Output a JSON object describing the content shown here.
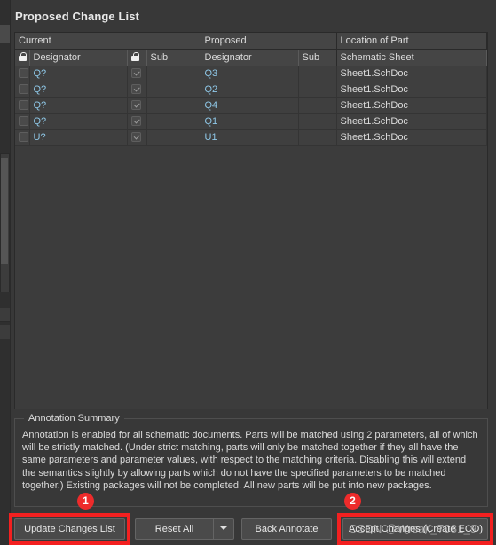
{
  "page_title": "Proposed Change List",
  "colors": {
    "window_bg": "#383838",
    "panel_bg": "#3c3c3c",
    "row_bg": "#3f3f3f",
    "header_bg": "#454545",
    "designator_text": "#8fc8e8",
    "highlight_red": "#f32020",
    "badge_red": "#ee2b2b"
  },
  "table": {
    "group_headers": [
      {
        "label": "Current"
      },
      {
        "label": "Proposed"
      },
      {
        "label": "Location of Part"
      }
    ],
    "sub_headers": {
      "current_lock_icon": "lock-icon",
      "current_designator": "Designator",
      "current_sub_lock_icon": "lock-icon",
      "current_sub": "Sub",
      "proposed_designator": "Designator",
      "proposed_sub": "Sub",
      "location": "Schematic Sheet"
    },
    "rows": [
      {
        "selected": false,
        "current_designator": "Q?",
        "current_sub_checked": true,
        "current_sub": "",
        "proposed_designator": "Q3",
        "proposed_sub": "",
        "location": "Sheet1.SchDoc"
      },
      {
        "selected": false,
        "current_designator": "Q?",
        "current_sub_checked": true,
        "current_sub": "",
        "proposed_designator": "Q2",
        "proposed_sub": "",
        "location": "Sheet1.SchDoc"
      },
      {
        "selected": false,
        "current_designator": "Q?",
        "current_sub_checked": true,
        "current_sub": "",
        "proposed_designator": "Q4",
        "proposed_sub": "",
        "location": "Sheet1.SchDoc"
      },
      {
        "selected": false,
        "current_designator": "Q?",
        "current_sub_checked": true,
        "current_sub": "",
        "proposed_designator": "Q1",
        "proposed_sub": "",
        "location": "Sheet1.SchDoc"
      },
      {
        "selected": false,
        "current_designator": "U?",
        "current_sub_checked": true,
        "current_sub": "",
        "proposed_designator": "U1",
        "proposed_sub": "",
        "location": "Sheet1.SchDoc"
      }
    ]
  },
  "summary": {
    "legend": "Annotation Summary",
    "text": "Annotation is enabled for all schematic documents. Parts will be matched using 2 parameters, all of which will be strictly matched. (Under strict matching, parts will only be matched together if they all have the same parameters and parameter values, with respect to the matching criteria. Disabling this will extend the semantics slightly by allowing parts which do not have the specified parameters to be matched together.) Existing packages will not be completed. All new parts will be put into new packages."
  },
  "buttons": {
    "update_changes_list": "Update Changes List",
    "reset_all": "Reset All",
    "reset_all_dropdown_icon": "chevron-down-icon",
    "back_annotate_accel": "B",
    "back_annotate_rest": "ack Annotate",
    "accept_changes": "Accept Changes (Create ECO)"
  },
  "annotations": {
    "badge_1": "1",
    "badge_2": "2"
  },
  "watermark": "CSDN @Wrsak_7081_9"
}
